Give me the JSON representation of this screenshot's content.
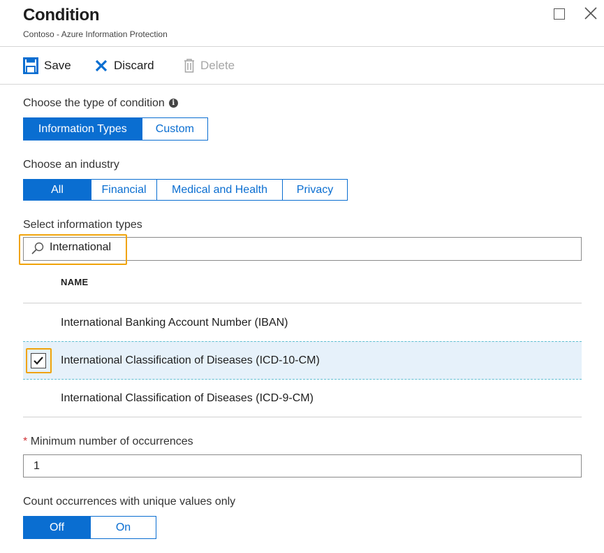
{
  "header": {
    "title": "Condition",
    "subtitle": "Contoso - Azure Information Protection"
  },
  "window_controls": {
    "maximize_icon": "maximize-icon",
    "close_icon": "close-icon"
  },
  "toolbar": {
    "save_label": "Save",
    "discard_label": "Discard",
    "delete_label": "Delete"
  },
  "condition_type": {
    "label": "Choose the type of condition",
    "options": [
      "Information Types",
      "Custom"
    ],
    "selected": "Information Types"
  },
  "industry": {
    "label": "Choose an industry",
    "options": [
      "All",
      "Financial",
      "Medical and Health",
      "Privacy"
    ],
    "selected": "All"
  },
  "info_types": {
    "label": "Select information types",
    "search_value": "International",
    "column_header": "NAME",
    "rows": [
      {
        "name": "International Banking Account Number (IBAN)",
        "checked": false
      },
      {
        "name": "International Classification of Diseases (ICD-10-CM)",
        "checked": true
      },
      {
        "name": "International Classification of Diseases (ICD-9-CM)",
        "checked": false
      }
    ]
  },
  "min_occurrences": {
    "required_marker": "*",
    "label": "Minimum number of occurrences",
    "value": "1"
  },
  "unique_values": {
    "label": "Count occurrences with unique values only",
    "options": [
      "Off",
      "On"
    ],
    "selected": "Off"
  },
  "colors": {
    "accent": "#0a6ed1",
    "highlight": "#f0a30a",
    "selected_row": "#e6f1fa",
    "required": "#d13438"
  }
}
